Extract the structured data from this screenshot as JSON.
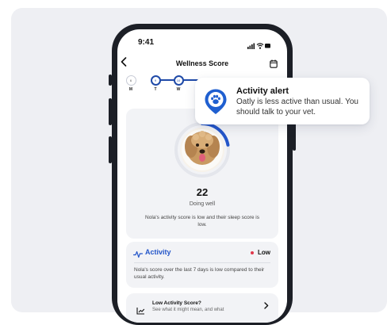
{
  "status_bar": {
    "time": "9:41"
  },
  "nav": {
    "title": "Wellness Score"
  },
  "days": [
    {
      "num": "6",
      "letter": "M",
      "active": false
    },
    {
      "num": "9",
      "letter": "T",
      "active": true
    },
    {
      "num": "10",
      "letter": "W",
      "active": true
    }
  ],
  "score_card": {
    "score": "22",
    "status": "Doing well",
    "description": "Nola's activity score is low and their sleep score is low.",
    "progress": 0.22
  },
  "activity_card": {
    "title": "Activity",
    "badge": "Low",
    "description": "Nola's score over the last 7 days is low compared to their usual activity."
  },
  "low_card": {
    "title": "Low Activity Score?",
    "subtitle": "See what it might mean, and what"
  },
  "alert": {
    "title": "Activity alert",
    "body": "Oatly is less active than usual. You should talk to your vet."
  },
  "colors": {
    "accent": "#2456c9",
    "alert_pin": "#1f5fd0",
    "low_dot": "#e0384b",
    "card_bg": "#f2f3f6"
  }
}
